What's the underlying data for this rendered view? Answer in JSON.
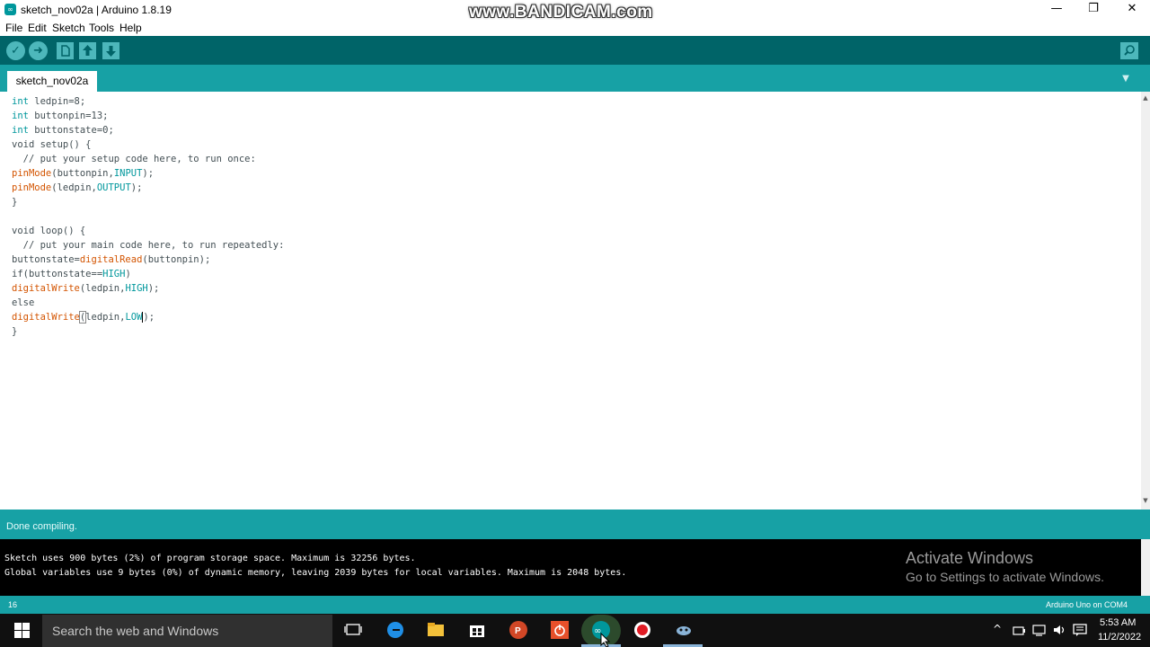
{
  "window": {
    "title": "sketch_nov02a | Arduino 1.8.19",
    "app_icon_glyph": "∞",
    "minimize": "—",
    "maximize": "❐",
    "close": "✕"
  },
  "watermark": "www.BANDICAM.com",
  "menu": [
    "File",
    "Edit",
    "Sketch",
    "Tools",
    "Help"
  ],
  "toolbar": {
    "verify_icon": "check-icon",
    "upload_icon": "arrow-right-icon",
    "new_icon": "new-file-icon",
    "open_icon": "arrow-up-icon",
    "save_icon": "arrow-down-icon",
    "serial_icon": "magnifier-icon",
    "accent": "#4db7bb",
    "bar": "#006468"
  },
  "tabs": [
    {
      "label": "sketch_nov02a"
    }
  ],
  "code": {
    "l1_type": "int",
    "l1_rest": " ledpin=8;",
    "l2_type": "int",
    "l2_rest": " buttonpin=13;",
    "l3_type": "int",
    "l3_rest": " buttonstate=0;",
    "l4": "void setup() {",
    "l5": "  // put your setup code here, to run once:",
    "l6_fn": "pinMode",
    "l6_a": "(buttonpin,",
    "l6_c": "INPUT",
    "l6_e": ");",
    "l7_fn": "pinMode",
    "l7_a": "(ledpin,",
    "l7_c": "OUTPUT",
    "l7_e": ");",
    "l8": "}",
    "l10": "void loop() {",
    "l11": "  // put your main code here, to run repeatedly:",
    "l12_a": "buttonstate=",
    "l12_fn": "digitalRead",
    "l12_e": "(buttonpin);",
    "l13_a": "if(buttonstate==",
    "l13_c": "HIGH",
    "l13_e": ")",
    "l14_fn": "digitalWrite",
    "l14_a": "(ledpin,",
    "l14_c": "HIGH",
    "l14_e": ");",
    "l15": "else",
    "l16_fn": "digitalWrite",
    "l16_b": "(",
    "l16_a": "ledpin,",
    "l16_c": "LOW",
    "l16_e": ");",
    "l17": "}"
  },
  "status": {
    "message": "Done compiling."
  },
  "console": {
    "line1": "Sketch uses 900 bytes (2%) of program storage space. Maximum is 32256 bytes.",
    "line2": "Global variables use 9 bytes (0%) of dynamic memory, leaving 2039 bytes for local variables. Maximum is 2048 bytes."
  },
  "activation": {
    "title": "Activate Windows",
    "subtitle": "Go to Settings to activate Windows."
  },
  "footer": {
    "line_number": "16",
    "board": "Arduino Uno on COM4"
  },
  "taskbar": {
    "search_placeholder": "Search the web and Windows",
    "apps": [
      "task-view-icon",
      "edge-icon",
      "file-explorer-icon",
      "store-icon",
      "powerpoint-icon",
      "power-app-icon",
      "arduino-icon",
      "record-icon",
      "app-icon"
    ],
    "time": "5:53 AM",
    "date": "11/2/2022",
    "tray_up": "^"
  }
}
